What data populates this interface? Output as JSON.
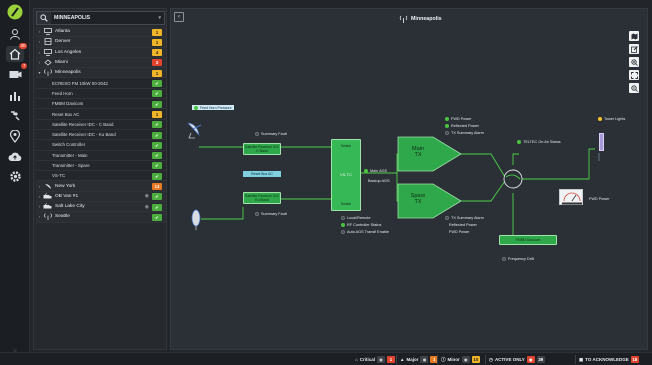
{
  "rail": {
    "icons": [
      "logo-icon",
      "user-icon",
      "home-icon",
      "alarm-icon",
      "chart-icon",
      "settings-hint-icon",
      "map-pin-icon",
      "cloud-icon",
      "gear-icon"
    ],
    "home_badge": "30",
    "alarm_badge": "7"
  },
  "search": {
    "value": "MINNEAPOLIS"
  },
  "sites": [
    {
      "name": "Atlanta",
      "status": "1",
      "level": "warn",
      "icon": "server-icon"
    },
    {
      "name": "Denver",
      "status": "1",
      "level": "warn",
      "icon": "rack-icon"
    },
    {
      "name": "Los Angeles",
      "status": "4",
      "level": "warn",
      "icon": "server-icon"
    },
    {
      "name": "Miami",
      "status": "3",
      "level": "crit",
      "icon": "satellite-icon"
    },
    {
      "name": "Minneapolis",
      "status": "1",
      "level": "warn",
      "icon": "antenna-icon",
      "expanded": true
    }
  ],
  "minneapolis_children": [
    {
      "name": "ECRESO FM 10kW 00-2042",
      "status": "✔",
      "level": "ok"
    },
    {
      "name": "Feed Horn",
      "status": "✔",
      "level": "ok"
    },
    {
      "name": "FMBM Davicom",
      "status": "✔",
      "level": "ok"
    },
    {
      "name": "Reset Box AC",
      "status": "1",
      "level": "warn"
    },
    {
      "name": "Satellite Receiver IDC - C Band",
      "status": "✔",
      "level": "ok"
    },
    {
      "name": "Satellite Receiver IDC - Ku Band",
      "status": "✔",
      "level": "ok"
    },
    {
      "name": "Switch Controller",
      "status": "✔",
      "level": "ok"
    },
    {
      "name": "Transmitter - Main",
      "status": "✔",
      "level": "ok"
    },
    {
      "name": "Transmitter - Spare",
      "status": "✔",
      "level": "ok"
    },
    {
      "name": "VS-TC",
      "status": "✔",
      "level": "ok"
    }
  ],
  "sites_after": [
    {
      "name": "New York",
      "status": "13",
      "level": "maj",
      "icon": "dish-icon"
    },
    {
      "name": "OB Van #1",
      "status": "✔",
      "level": "ok",
      "icon": "van-icon",
      "eye": true
    },
    {
      "name": "Salt Lake City",
      "status": "✔",
      "level": "ok",
      "icon": "van-icon",
      "eye": true
    },
    {
      "name": "Seattle",
      "status": "✔",
      "level": "ok",
      "icon": "antenna-icon"
    }
  ],
  "diagram": {
    "title": "Minneapolis",
    "feed_horn_pressure": "Feed Horn Pressure",
    "summary_fault_top": "Summary Fault",
    "sat_c_band": "Satellite Receiver IDC\nC Band",
    "reset_box": "Reset Box AC",
    "sat_ku_band": "Satellite Receiver IDC\nKu Band",
    "summary_fault_bottom": "Summary Fault",
    "switch_controller": "VS-TC",
    "switch_label": "Switch",
    "main_ags": "Main AGS",
    "backup_ags": "Backup AGS",
    "local_remote": "Local/Remote",
    "rf_controller_status": "RF Controller Status",
    "auto_ags": "Auto AGS Transfl Enable",
    "main_tx": "Main\nTX",
    "spare_tx": "Spare\nTX",
    "fwd_power_main": "FWD Power",
    "reflected_main": "Reflected Power",
    "tx_summary_main": "TX Summary Alarm",
    "tx_summary_spare": "TX Summary Alarm",
    "reflected_spare": "Reflected Power",
    "fwd_power_spare": "FWD Power",
    "on_air_status": "TELTEC On Air Status",
    "tower_lights": "Tower Lights",
    "fwd_power_meter": "FWD Power",
    "fmbm_davicom": "FMBM Davicom",
    "frequency_drift": "Frequency Drift"
  },
  "statusbar": {
    "critical_label": "Critical",
    "critical_count": "1",
    "major_label": "Major",
    "major_count": "1",
    "minor_label": "Minor",
    "minor_count": "10",
    "active_only_label": "ACTIVE ONLY",
    "active_only_count": "39",
    "to_ack_label": "TO ACKNOWLEDGE",
    "to_ack_count": "18"
  },
  "colors": {
    "ok": "#4cae3f",
    "warn": "#f0b428",
    "crit": "#e0442f",
    "maj": "#e87a24",
    "line": "#4cd14a"
  }
}
